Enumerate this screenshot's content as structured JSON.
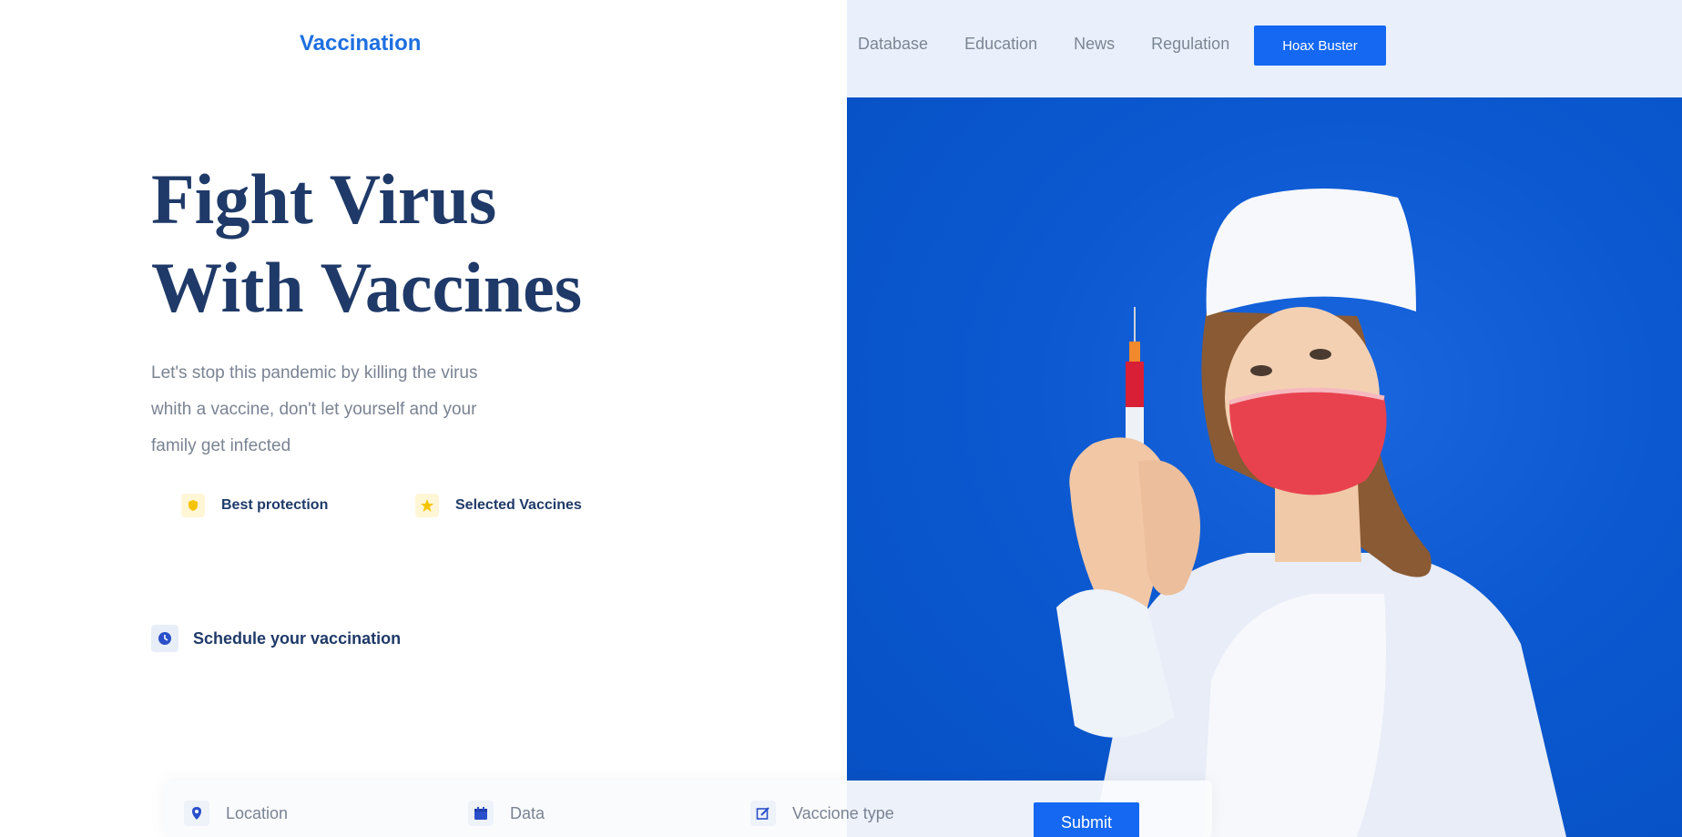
{
  "header": {
    "logo": "Vaccination",
    "nav": [
      "Database",
      "Education",
      "News",
      "Regulation"
    ],
    "cta_label": "Hoax Buster"
  },
  "hero": {
    "title_line1": "Fight Virus",
    "title_line2": "With Vaccines",
    "subtitle_line1": "Let's stop this pandemic by killing the virus",
    "subtitle_line2": "whith a vaccine, don't let yourself and your",
    "subtitle_line3": "family get infected",
    "features": [
      {
        "label": "Best protection",
        "icon": "shield-icon"
      },
      {
        "label": "Selected Vaccines",
        "icon": "star-icon"
      }
    ]
  },
  "schedule": {
    "label": "Schedule your vaccination",
    "icon": "clock-icon"
  },
  "form": {
    "location": "Location",
    "data": "Data",
    "vaccine_type": "Vaccione type",
    "submit": "Submit"
  },
  "colors": {
    "brand": "#1e6fe0",
    "button": "#1468f2",
    "heading": "#1f3a68",
    "photo_bg": "#0650c3"
  }
}
